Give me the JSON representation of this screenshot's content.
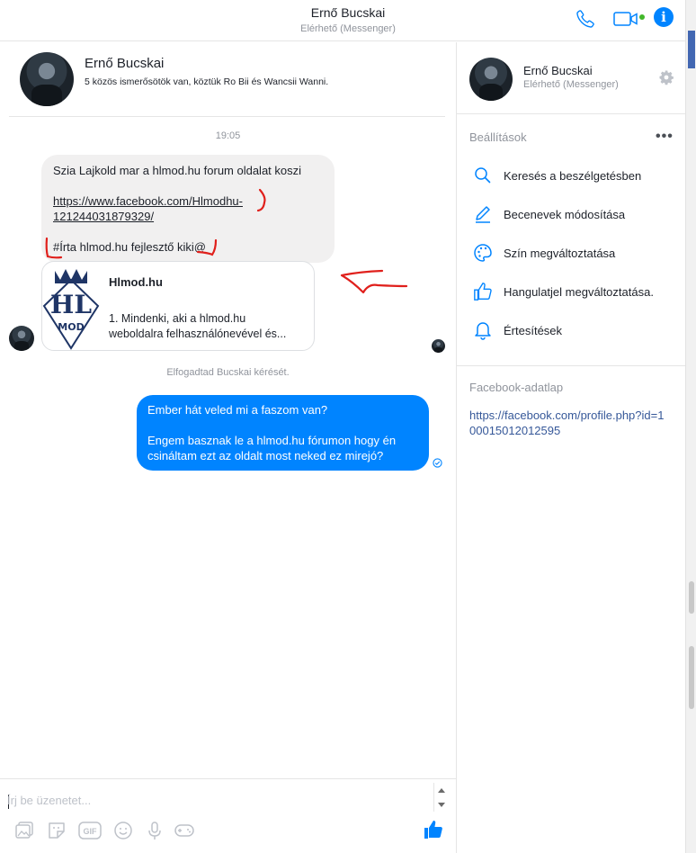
{
  "header": {
    "title": "Ernő Bucskai",
    "subtitle": "Elérhető (Messenger)"
  },
  "colors": {
    "accent": "#0084ff",
    "online": "#42b72a",
    "annotation": "#e0201c",
    "link": "#365899"
  },
  "profile": {
    "name": "Ernő Bucskai",
    "mutual": "5 közös ismerősötök van, köztük Ro Bii és Wancsii Wanni."
  },
  "conversation": {
    "time": "19:05",
    "incoming": {
      "line1": "Szia Lajkold mar a hlmod.hu forum oldalat koszi",
      "link_line1": "https://www.facebook.com/Hlmodhu-",
      "link_line2": "121244031879329/",
      "line3": "#Írta hlmod.hu fejlesztő kiki@"
    },
    "link_card": {
      "logo_text_top": "HL",
      "logo_text_bottom": "MOD",
      "title": "Hlmod.hu",
      "desc_line1": "1. Mindenki, aki a hlmod.hu",
      "desc_line2": "weboldalra felhasználónevével és..."
    },
    "system": "Elfogadtad Bucskai kérését.",
    "outgoing": {
      "line1": "Ember hát veled mi a faszom van?",
      "line2": "Engem basznak le a hlmod.hu fórumon hogy én",
      "line3": "csináltam ezt az oldalt most neked ez mirejó?"
    }
  },
  "composer": {
    "placeholder": "Írj be üzenetet...",
    "tools": {
      "gif_label": "GIF"
    }
  },
  "sidebar": {
    "name": "Ernő Bucskai",
    "status": "Elérhető (Messenger)",
    "settings_title": "Beállítások",
    "more": "•••",
    "items": [
      {
        "label": "Keresés a beszélgetésben",
        "icon": "search-icon"
      },
      {
        "label": "Becenevek módosítása",
        "icon": "pencil-icon"
      },
      {
        "label": "Szín megváltoztatása",
        "icon": "palette-icon"
      },
      {
        "label": "Hangulatjel megváltoztatása.",
        "icon": "thumbs-up-icon"
      },
      {
        "label": "Értesítések",
        "icon": "bell-icon"
      }
    ],
    "profile_title": "Facebook-adatlap",
    "profile_link": "https://facebook.com/profile.php?id=100015012012595"
  }
}
